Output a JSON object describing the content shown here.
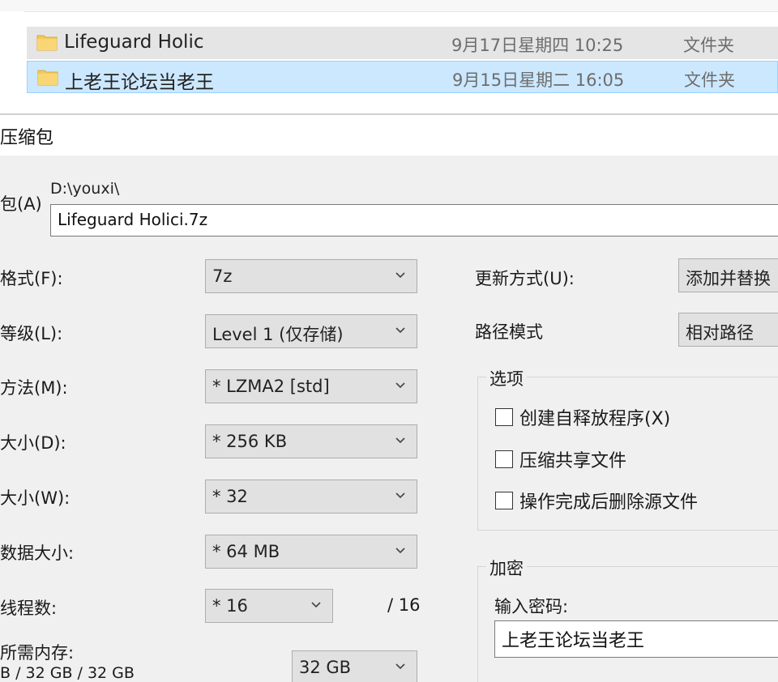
{
  "explorer": {
    "files": [
      {
        "name": "Lifeguard Holic",
        "date": "9月17日星期四 10:25",
        "type": "文件夹"
      },
      {
        "name": "上老王论坛当老王",
        "date": "9月15日星期二 16:05",
        "type": "文件夹"
      }
    ]
  },
  "dialog": {
    "title": "压缩包",
    "archive_label": "包(A)",
    "path": "D:\\youxi\\",
    "archive_name": "Lifeguard Holici.7z",
    "left_fields": [
      {
        "label": "格式(F):",
        "value": "7z"
      },
      {
        "label": "等级(L):",
        "value": "Level 1 (仅存储)"
      },
      {
        "label": "方法(M):",
        "value": "*  LZMA2 [std]"
      },
      {
        "label": "大小(D):",
        "value": "*  256 KB"
      },
      {
        "label": "大小(W):",
        "value": "*  32"
      },
      {
        "label": "数据大小:",
        "value": "*  64 MB"
      },
      {
        "label": "线程数:",
        "value": "*  16"
      }
    ],
    "threads_max": "/ 16",
    "memory_label": "所需内存:",
    "memory_value": "B / 32 GB / 32 GB",
    "memory_combo": "32 GB",
    "update_label": "更新方式(U):",
    "update_value": "添加并替换",
    "path_mode_label": "路径模式",
    "path_mode_value": "相对路径",
    "options_title": "选项",
    "options": [
      {
        "label": "创建自释放程序(X)",
        "checked": false
      },
      {
        "label": "压缩共享文件",
        "checked": false
      },
      {
        "label": "操作完成后删除源文件",
        "checked": false
      }
    ],
    "encrypt_title": "加密",
    "password_label": "输入密码:",
    "password_value": "上老王论坛当老王"
  },
  "icons": {
    "folder": "folder-icon",
    "chevron": "chevron-down-icon",
    "folder_color": "#f3c95a"
  }
}
